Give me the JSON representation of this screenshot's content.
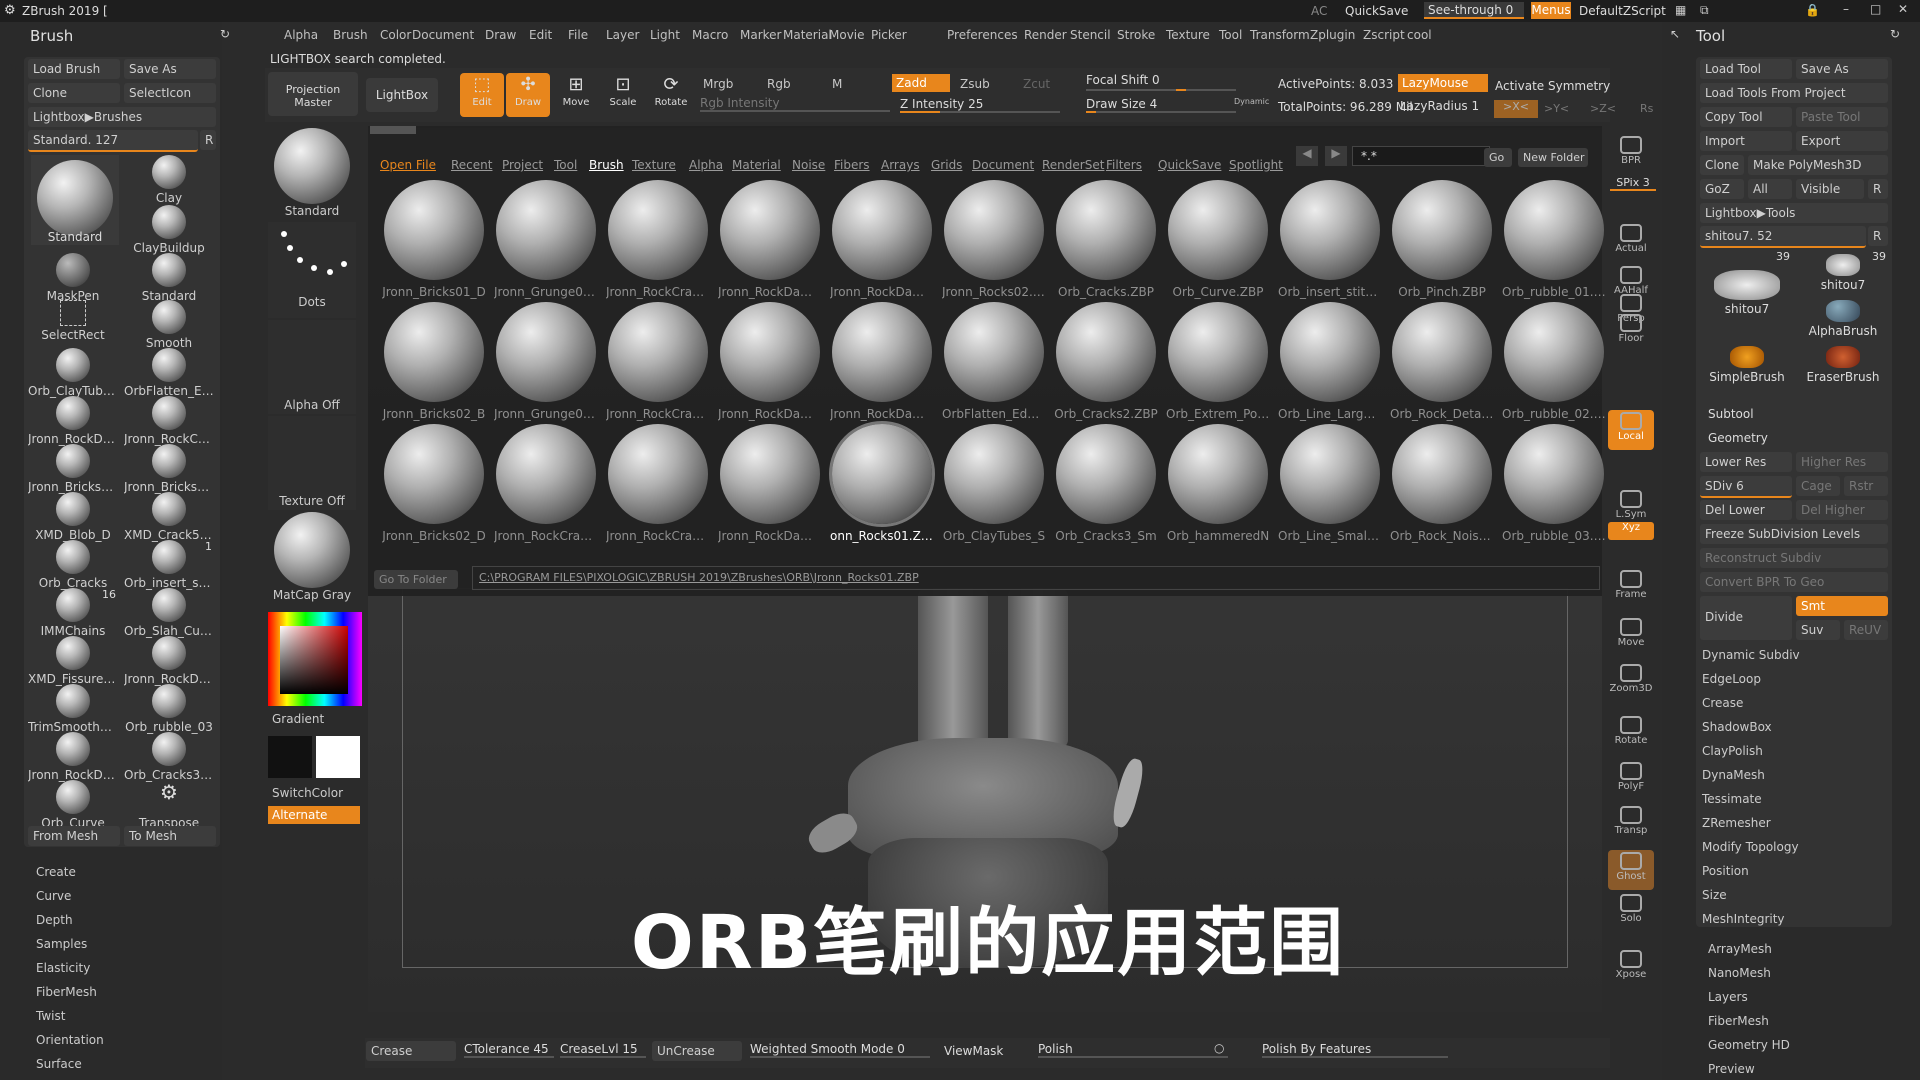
{
  "title_bar": {
    "app_title": "ZBrush 2019 [",
    "ac": "AC",
    "quicksave": "QuickSave",
    "see_through": "See-through 0",
    "menus": "Menus",
    "zscript": "DefaultZScript"
  },
  "menu_bar": [
    "Alpha",
    "Brush",
    "Color",
    "Document",
    "Draw",
    "Edit",
    "File",
    "Layer",
    "Light",
    "Macro",
    "Marker",
    "Material",
    "Movie",
    "Picker",
    "Preferences",
    "Render",
    "Stencil",
    "Stroke",
    "Texture",
    "Tool",
    "Transform",
    "Zplugin",
    "Zscript",
    "cool"
  ],
  "status_message": "LIGHTBOX search completed.",
  "left_panel": {
    "title": "Brush",
    "load_brush": "Load Brush",
    "save_as": "Save As",
    "clone": "Clone",
    "select_icon": "SelectIcon",
    "lightbox_brushes": "Lightbox▶Brushes",
    "standard_value": "Standard. 127",
    "r_btn": "R",
    "brushes": [
      {
        "label": "Standard"
      },
      {
        "label": "Clay"
      },
      {
        "label": "ClayBuildup"
      },
      {
        "label": "MaskPen"
      },
      {
        "label": "Standard"
      },
      {
        "label": "SelectRect"
      },
      {
        "label": "Smooth"
      },
      {
        "label": "Orb_ClayTubes_S"
      },
      {
        "label": "OrbFlatten_Edge"
      },
      {
        "label": "Jronn_RockDama"
      },
      {
        "label": "Jronn_RockCrack"
      },
      {
        "label": "Jronn_Bricks01_C"
      },
      {
        "label": "Jronn_Bricks01_D"
      },
      {
        "label": "XMD_Blob_D"
      },
      {
        "label": "XMD_Crack5_D"
      },
      {
        "label": "Orb_Cracks",
        "num": ""
      },
      {
        "label": "Orb_insert_stitch",
        "num": "1"
      },
      {
        "label": "IMMChains",
        "num": "16"
      },
      {
        "label": "Orb_Slah_Curve"
      },
      {
        "label": "XMD_Fissure3_D"
      },
      {
        "label": "Jronn_RockDama"
      },
      {
        "label": "TrimSmoothBorc"
      },
      {
        "label": "Orb_rubble_03"
      },
      {
        "label": "Jronn_RockDama"
      },
      {
        "label": "Orb_Cracks3_Sm"
      },
      {
        "label": "Orb_Curve"
      },
      {
        "label": "Transpose"
      }
    ],
    "from_mesh": "From Mesh",
    "to_mesh": "To Mesh",
    "subpalettes": [
      "Create",
      "Curve",
      "Depth",
      "Samples",
      "Elasticity",
      "FiberMesh",
      "Twist",
      "Orientation",
      "Surface"
    ]
  },
  "shelf": {
    "projection_master": "Projection Master",
    "lightbox": "LightBox",
    "edit": "Edit",
    "draw": "Draw",
    "move": "Move",
    "scale": "Scale",
    "rotate": "Rotate",
    "mrgb": "Mrgb",
    "rgb": "Rgb",
    "m": "M",
    "rgb_intensity": "Rgb Intensity",
    "zadd": "Zadd",
    "zsub": "Zsub",
    "zcut": "Zcut",
    "z_intensity": "Z Intensity 25",
    "focal_shift": "Focal Shift 0",
    "draw_size": "Draw Size 4",
    "dynamic": "Dynamic",
    "active_points": "ActivePoints: 8.033 M",
    "total_points": "TotalPoints: 96.289 Mil",
    "lazymouse": "LazyMouse",
    "lazyradius": "LazyRadius 1",
    "activate_symmetry": "Activate Symmetry",
    "axes": [
      ">X<",
      ">Y<",
      ">Z<",
      "Rs"
    ]
  },
  "left_shelf": {
    "standard": "Standard",
    "dots": "Dots",
    "alpha_off": "Alpha Off",
    "texture_off": "Texture Off",
    "matcap": "MatCap Gray",
    "gradient": "Gradient",
    "switchcolor": "SwitchColor",
    "alternate": "Alternate"
  },
  "lightbox": {
    "tabs": [
      "Open File",
      "Recent",
      "Project",
      "Tool",
      "Brush",
      "Texture",
      "Alpha",
      "Material",
      "Noise",
      "Fibers",
      "Arrays",
      "Grids",
      "Document",
      "RenderSet",
      "Filters",
      "QuickSave",
      "Spotlight"
    ],
    "active_tab": "Brush",
    "search_value": "*.*",
    "go": "Go",
    "new_folder": "New Folder",
    "items": [
      "Jronn_Bricks01_D",
      "Jronn_Grunge01.Z",
      "Jronn_RockCrack(",
      "Jronn_RockDama(",
      "Jronn_RockDama(",
      "Jronn_Rocks02.ZB",
      "Orb_Cracks.ZBP",
      "Orb_Curve.ZBP",
      "Orb_insert_stitch.",
      "Orb_Pinch.ZBP",
      "Orb_rubble_01.ZB",
      "Jronn_Bricks02_B",
      "Jronn_Grunge02.Z",
      "Jronn_RockCrack(",
      "Jronn_RockDama(",
      "Jronn_RockDama(",
      "OrbFlatten_EdgeF",
      "Orb_Cracks2.ZBP",
      "Orb_Extrem_Polis",
      "Orb_Line_Large.Z",
      "Orb_Rock_Detail.Z",
      "Orb_rubble_02.ZB",
      "Jronn_Bricks02_D",
      "Jronn_RockCrack(",
      "Jronn_RockCrack(",
      "Jronn_RockDama(",
      "onn_Rocks01.ZBP",
      "Orb_ClayTubes_S",
      "Orb_Cracks3_Sm",
      "Orb_hammeredN",
      "Orb_Line_Small.Z",
      "Orb_Rock_Noise.Z",
      "Orb_rubble_03.ZB"
    ],
    "selected": "onn_Rocks01.ZBP",
    "go_to_folder": "Go To Folder",
    "path": "C:\\PROGRAM FILES\\PIXOLOGIC\\ZBRUSH 2019\\ZBrushes\\ORB\\Jronn_Rocks01.ZBP"
  },
  "subtitle": "ORB笔刷的应用范围",
  "bottom_bar": {
    "crease": "Crease",
    "ctolerance": "CTolerance 45",
    "creaselvl": "CreaseLvl 15",
    "uncrease": "UnCrease",
    "weighted": "Weighted Smooth Mode 0",
    "viewmask": "ViewMask",
    "polish": "Polish",
    "polish_features": "Polish By Features"
  },
  "right_shelf": [
    "BPR",
    "SPix 3",
    "Actual",
    "AAHalf",
    "Persp",
    "Floor",
    "Local",
    "L.Sym",
    "Xyz",
    "Frame",
    "Move",
    "Zoom3D",
    "Rotate",
    "PolyF",
    "Transp",
    "Ghost",
    "Solo",
    "Xpose"
  ],
  "right_panel": {
    "title": "Tool",
    "load_tool": "Load Tool",
    "save_as": "Save As",
    "load_from_project": "Load Tools From Project",
    "copy_tool": "Copy Tool",
    "paste_tool": "Paste Tool",
    "import": "Import",
    "export": "Export",
    "clone": "Clone",
    "make_polymesh": "Make PolyMesh3D",
    "goz": "GoZ",
    "all": "All",
    "visible": "Visible",
    "r": "R",
    "lightbox_tools": "Lightbox▶Tools",
    "shitou_value": "shitou7. 52",
    "tools": [
      {
        "label": "shitou7",
        "num": "39"
      },
      {
        "label": "shitou7",
        "num": "39"
      },
      {
        "label": "AlphaBrush",
        "num": ""
      },
      {
        "label": "SimpleBrush",
        "num": ""
      },
      {
        "label": "EraserBrush",
        "num": ""
      }
    ],
    "subtool": "Subtool",
    "geometry": "Geometry",
    "lower_res": "Lower Res",
    "higher_res": "Higher Res",
    "sdiv": "SDiv 6",
    "cage": "Cage",
    "rstr": "Rstr",
    "del_lower": "Del Lower",
    "del_higher": "Del Higher",
    "freeze": "Freeze SubDivision Levels",
    "reconstruct": "Reconstruct Subdiv",
    "convert_bpr": "Convert BPR To Geo",
    "divide": "Divide",
    "smt": "Smt",
    "suv": "Suv",
    "reuv": "ReUV",
    "geo_items": [
      "Dynamic Subdiv",
      "EdgeLoop",
      "Crease",
      "ShadowBox",
      "ClayPolish",
      "DynaMesh",
      "Tessimate",
      "ZRemesher",
      "Modify Topology",
      "Position",
      "Size",
      "MeshIntegrity"
    ],
    "after_items": [
      "ArrayMesh",
      "NanoMesh",
      "Layers",
      "FiberMesh",
      "Geometry HD",
      "Preview"
    ]
  },
  "colors": {
    "accent": "#e8861c",
    "panel": "#2f2f2f",
    "bg": "#2b2b2b"
  }
}
